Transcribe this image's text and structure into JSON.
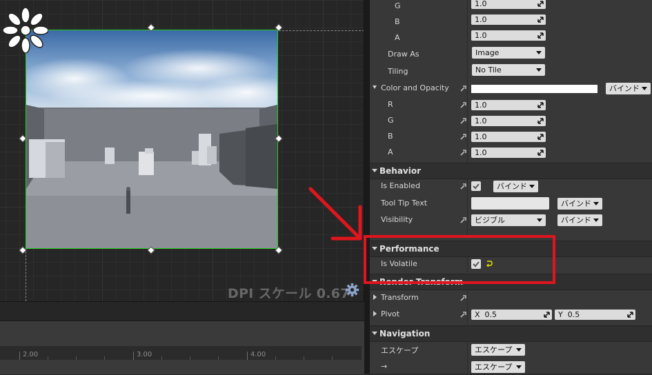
{
  "viewport": {
    "dpi_label": "DPI スケール 0.67",
    "icons": {
      "anchor": "anchor-flower-icon",
      "settings": "gear-icon"
    }
  },
  "timeline": {
    "ticks": [
      "2.00",
      "3.00",
      "4.00"
    ]
  },
  "details": {
    "brush_rows": [
      {
        "label": "G",
        "value": "1.0"
      },
      {
        "label": "B",
        "value": "1.0"
      },
      {
        "label": "A",
        "value": "1.0"
      }
    ],
    "draw_as": {
      "label": "Draw As",
      "value": "Image"
    },
    "tiling": {
      "label": "Tiling",
      "value": "No Tile"
    },
    "color_opacity": {
      "label": "Color and Opacity",
      "swatch": "#ffffff",
      "bind": "バインド"
    },
    "color_rows": [
      {
        "label": "R",
        "value": "1.0"
      },
      {
        "label": "G",
        "value": "1.0"
      },
      {
        "label": "B",
        "value": "1.0"
      },
      {
        "label": "A",
        "value": "1.0"
      }
    ],
    "behavior": {
      "title": "Behavior",
      "is_enabled": {
        "label": "Is Enabled",
        "checked": true,
        "bind": "バインド"
      },
      "tooltip": {
        "label": "Tool Tip Text",
        "value": "",
        "bind": "バインド"
      },
      "visibility": {
        "label": "Visibility",
        "value": "ビジブル",
        "bind": "バインド"
      }
    },
    "performance": {
      "title": "Performance",
      "is_volatile": {
        "label": "Is Volatile",
        "checked": true
      }
    },
    "render_transform": {
      "title": "Render Transform",
      "transform": {
        "label": "Transform"
      },
      "pivot": {
        "label": "Pivot",
        "x_label": "X",
        "x_value": "0.5",
        "y_label": "Y",
        "y_value": "0.5"
      }
    },
    "navigation": {
      "title": "Navigation",
      "escape": {
        "label": "エスケープ",
        "value": "エスケープ"
      },
      "right": {
        "label": "→",
        "value": "エスケープ"
      }
    }
  },
  "colors": {
    "selection_green": "#23d123",
    "annotation_red": "#e0151d"
  }
}
